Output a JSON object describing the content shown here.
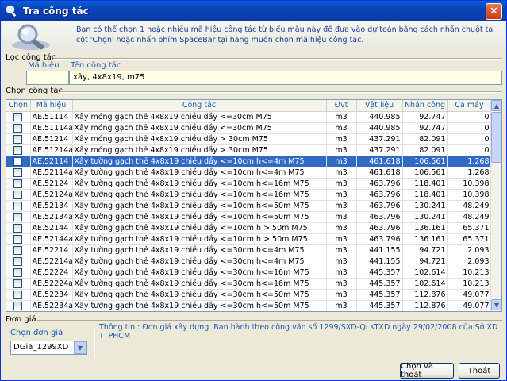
{
  "window": {
    "title": "Tra công tác",
    "close_glyph": "✕"
  },
  "banner": {
    "hint": "Bạn có thể chọn 1 hoặc nhiều mã hiệu công tác từ biểu mẫu này để đưa vào dự toán bằng cách nhấn chuột tại cột 'Chọn' hoặc nhấn phím SpaceBar tại hàng muốn chọn mã hiệu công tác."
  },
  "filter": {
    "group_title": "Lọc công tác",
    "code_label": "Mã hiệu",
    "name_label": "Tên công tác",
    "code_value": "",
    "name_value": "xây, 4x8x19, m75"
  },
  "select_group": {
    "title": "Chọn công tác"
  },
  "columns": [
    "Chọn",
    "Mã hiệu",
    "Công tác",
    "Đvt",
    "Vật liệu",
    "Nhân công",
    "Ca máy"
  ],
  "rows": [
    {
      "code": "AE.51114",
      "name": "Xây móng gạch thẻ 4x8x19 chiều dầy <=30cm M75",
      "unit": "m3",
      "mat": "440.985",
      "labor": "92.747",
      "machine": "0",
      "selected": false
    },
    {
      "code": "AE.51114a",
      "name": "Xây móng gạch thẻ 4x8x19 chiều dầy <=30cm M75",
      "unit": "m3",
      "mat": "440.985",
      "labor": "92.747",
      "machine": "0",
      "selected": false
    },
    {
      "code": "AE.51214",
      "name": "Xây móng gạch thẻ 4x8x19 chiều dầy > 30cm M75",
      "unit": "m3",
      "mat": "437.291",
      "labor": "82.091",
      "machine": "0",
      "selected": false
    },
    {
      "code": "AE.51214a",
      "name": "Xây móng gạch thẻ 4x8x19 chiều dầy > 30cm M75",
      "unit": "m3",
      "mat": "437.291",
      "labor": "82.091",
      "machine": "0",
      "selected": false
    },
    {
      "code": "AE.52114",
      "name": "Xây tường gạch thẻ 4x8x19 chiều dầy <=10cm h<=4m M75",
      "unit": "m3",
      "mat": "461.618",
      "labor": "106.561",
      "machine": "1.268",
      "selected": true
    },
    {
      "code": "AE.52114a",
      "name": "Xây tường gạch thẻ 4x8x19 chiều dầy <=10cm h<=4m M75",
      "unit": "m3",
      "mat": "461.618",
      "labor": "106.561",
      "machine": "1.268",
      "selected": false
    },
    {
      "code": "AE.52124",
      "name": "Xây tường gạch thẻ 4x8x19 chiều dầy <=10cm h<=16m M75",
      "unit": "m3",
      "mat": "463.796",
      "labor": "118.401",
      "machine": "10.398",
      "selected": false
    },
    {
      "code": "AE.52124a",
      "name": "Xây tường gạch thẻ 4x8x19 chiều dầy <=10cm h<=16m M75",
      "unit": "m3",
      "mat": "463.796",
      "labor": "118.401",
      "machine": "10.398",
      "selected": false
    },
    {
      "code": "AE.52134",
      "name": "Xây tường gạch thẻ 4x8x19 chiều dầy <=10cm h<=50m M75",
      "unit": "m3",
      "mat": "463.796",
      "labor": "130.241",
      "machine": "48.249",
      "selected": false
    },
    {
      "code": "AE.52134a",
      "name": "Xây tường gạch thẻ 4x8x19 chiều dầy <=10cm h<=50m M75",
      "unit": "m3",
      "mat": "463.796",
      "labor": "130.241",
      "machine": "48.249",
      "selected": false
    },
    {
      "code": "AE.52144",
      "name": "Xây tường gạch thẻ 4x8x19 chiều dầy <=10cm h > 50m M75",
      "unit": "m3",
      "mat": "463.796",
      "labor": "136.161",
      "machine": "65.371",
      "selected": false
    },
    {
      "code": "AE.52144a",
      "name": "Xây tường gạch thẻ 4x8x19 chiều dầy <=10cm h > 50m M75",
      "unit": "m3",
      "mat": "463.796",
      "labor": "136.161",
      "machine": "65.371",
      "selected": false
    },
    {
      "code": "AE.52214",
      "name": "Xây tường gạch thẻ 4x8x19 chiều dầy <=30cm h<=4m M75",
      "unit": "m3",
      "mat": "441.155",
      "labor": "94.721",
      "machine": "2.093",
      "selected": false
    },
    {
      "code": "AE.52214a",
      "name": "Xây tường gạch thẻ 4x8x19 chiều dầy <=30cm h<=4m M75",
      "unit": "m3",
      "mat": "441.155",
      "labor": "94.721",
      "machine": "2.093",
      "selected": false
    },
    {
      "code": "AE.52224",
      "name": "Xây tường gạch thẻ 4x8x19 chiều dầy <=30cm h<=16m M75",
      "unit": "m3",
      "mat": "445.357",
      "labor": "102.614",
      "machine": "10.213",
      "selected": false
    },
    {
      "code": "AE.52224a",
      "name": "Xây tường gạch thẻ 4x8x19 chiều dầy <=30cm h<=16m M75",
      "unit": "m3",
      "mat": "445.357",
      "labor": "102.614",
      "machine": "10.213",
      "selected": false
    },
    {
      "code": "AE.52234",
      "name": "Xây tường gạch thẻ 4x8x19 chiều dầy <=30cm h<=50m M75",
      "unit": "m3",
      "mat": "445.357",
      "labor": "112.876",
      "machine": "49.077",
      "selected": false
    },
    {
      "code": "AE.52234a",
      "name": "Xây tường gạch thẻ 4x8x19 chiều dầy <=30cm h<=50m M75",
      "unit": "m3",
      "mat": "445.357",
      "labor": "112.876",
      "machine": "49.077",
      "selected": false
    }
  ],
  "pricing": {
    "group_title": "Đơn giá",
    "select_label": "Chọn đơn giá",
    "selected": "DGia_1299XD",
    "info": "Thông tin : Đơn giá xây dựng. Ban hành theo công văn số 1299/SXD-QLKTXD ngày 29/02/2008 của Sở XD TTPHCM"
  },
  "buttons": {
    "select_exit": "Chọn và thoát",
    "exit": "Thoát"
  },
  "colors": {
    "selection": "#316AC5",
    "header_blue": "#1A5BB8",
    "titlebar": "#0842B8"
  }
}
